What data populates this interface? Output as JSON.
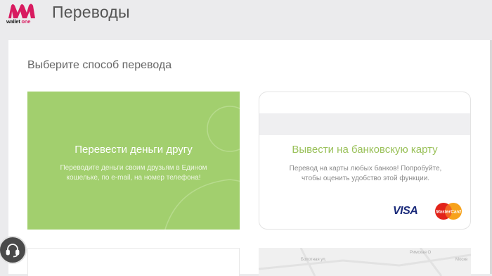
{
  "app": {
    "logo_text_main": "wallet ",
    "logo_text_accent": "one",
    "page_title": "Переводы"
  },
  "main": {
    "subtitle": "Выберите способ перевода",
    "cards": [
      {
        "title": "Перевести деньги другу",
        "description": "Переводите деньги своим друзьям в Едином кошельке, по e-mail, на номер телефона!"
      },
      {
        "title": "Вывести на банковскую карту",
        "description": "Перевод на карты любых банков! Попробуйте, чтобы оценить удобство этой функции.",
        "visa_label": "VISA",
        "mastercard_label": "MasterCard"
      }
    ],
    "map_labels": [
      "Болотная ул.",
      "Римская О",
      "Москв"
    ]
  },
  "colors": {
    "brand": "#d81b60",
    "green_card": "#a2cf6e",
    "green_title": "#9ac15a"
  },
  "icons": {
    "logo": "wallet-one-logo-icon",
    "support": "headset-icon",
    "person_outline": "person-outline-icon"
  }
}
